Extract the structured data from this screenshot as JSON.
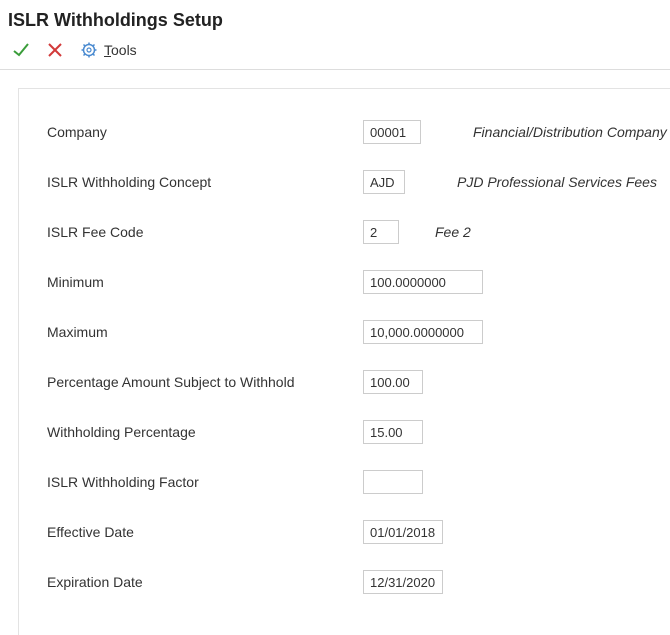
{
  "title": "ISLR Withholdings Setup",
  "toolbar": {
    "tools": "Tools"
  },
  "form": {
    "company": {
      "label": "Company",
      "value": "00001",
      "desc": "Financial/Distribution Company"
    },
    "concept": {
      "label": "ISLR Withholding Concept",
      "value": "AJD",
      "desc": "PJD Professional Services Fees"
    },
    "feeCode": {
      "label": "ISLR Fee Code",
      "value": "2",
      "desc": "Fee 2"
    },
    "minimum": {
      "label": "Minimum",
      "value": "100.0000000"
    },
    "maximum": {
      "label": "Maximum",
      "value": "10,000.0000000"
    },
    "pctSubject": {
      "label": "Percentage Amount Subject to Withhold",
      "value": "100.00"
    },
    "withPct": {
      "label": "Withholding Percentage",
      "value": "15.00"
    },
    "factor": {
      "label": "ISLR Withholding Factor",
      "value": ""
    },
    "effDate": {
      "label": "Effective Date",
      "value": "01/01/2018"
    },
    "expDate": {
      "label": "Expiration Date",
      "value": "12/31/2020"
    }
  }
}
